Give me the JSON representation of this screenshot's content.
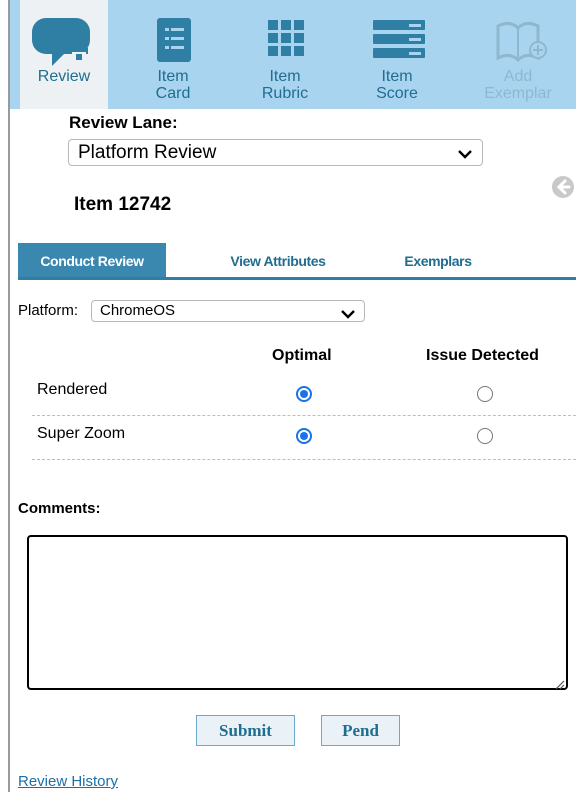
{
  "toolbar": {
    "items": [
      {
        "label_line1": "Review",
        "label_line2": "",
        "icon": "chat-add-icon",
        "state": "active"
      },
      {
        "label_line1": "Item",
        "label_line2": "Card",
        "icon": "card-list-icon",
        "state": "normal"
      },
      {
        "label_line1": "Item",
        "label_line2": "Rubric",
        "icon": "grid-icon",
        "state": "normal"
      },
      {
        "label_line1": "Item",
        "label_line2": "Score",
        "icon": "score-bars-icon",
        "state": "normal"
      },
      {
        "label_line1": "Add",
        "label_line2": "Exemplar",
        "icon": "book-add-icon",
        "state": "disabled"
      }
    ]
  },
  "review_lane": {
    "label": "Review Lane:",
    "selected": "Platform Review"
  },
  "item": {
    "title": "Item 12742"
  },
  "tabs": [
    {
      "label": "Conduct Review",
      "active": true
    },
    {
      "label": "View Attributes",
      "active": false
    },
    {
      "label": "Exemplars",
      "active": false
    }
  ],
  "platform": {
    "label": "Platform:",
    "selected": "ChromeOS"
  },
  "grid": {
    "columns": [
      "Optimal",
      "Issue Detected"
    ],
    "rows": [
      {
        "label": "Rendered",
        "selected": "Optimal"
      },
      {
        "label": "Super Zoom",
        "selected": "Optimal"
      }
    ]
  },
  "comments": {
    "label": "Comments:",
    "value": ""
  },
  "buttons": {
    "submit": "Submit",
    "pend": "Pend"
  },
  "links": {
    "history": "Review History"
  },
  "colors": {
    "toolbar_bg": "#a9d4ef",
    "icon_teal": "#2f7fa5",
    "tab_active": "#3a88b0",
    "radio_selected": "#1a73e8"
  }
}
